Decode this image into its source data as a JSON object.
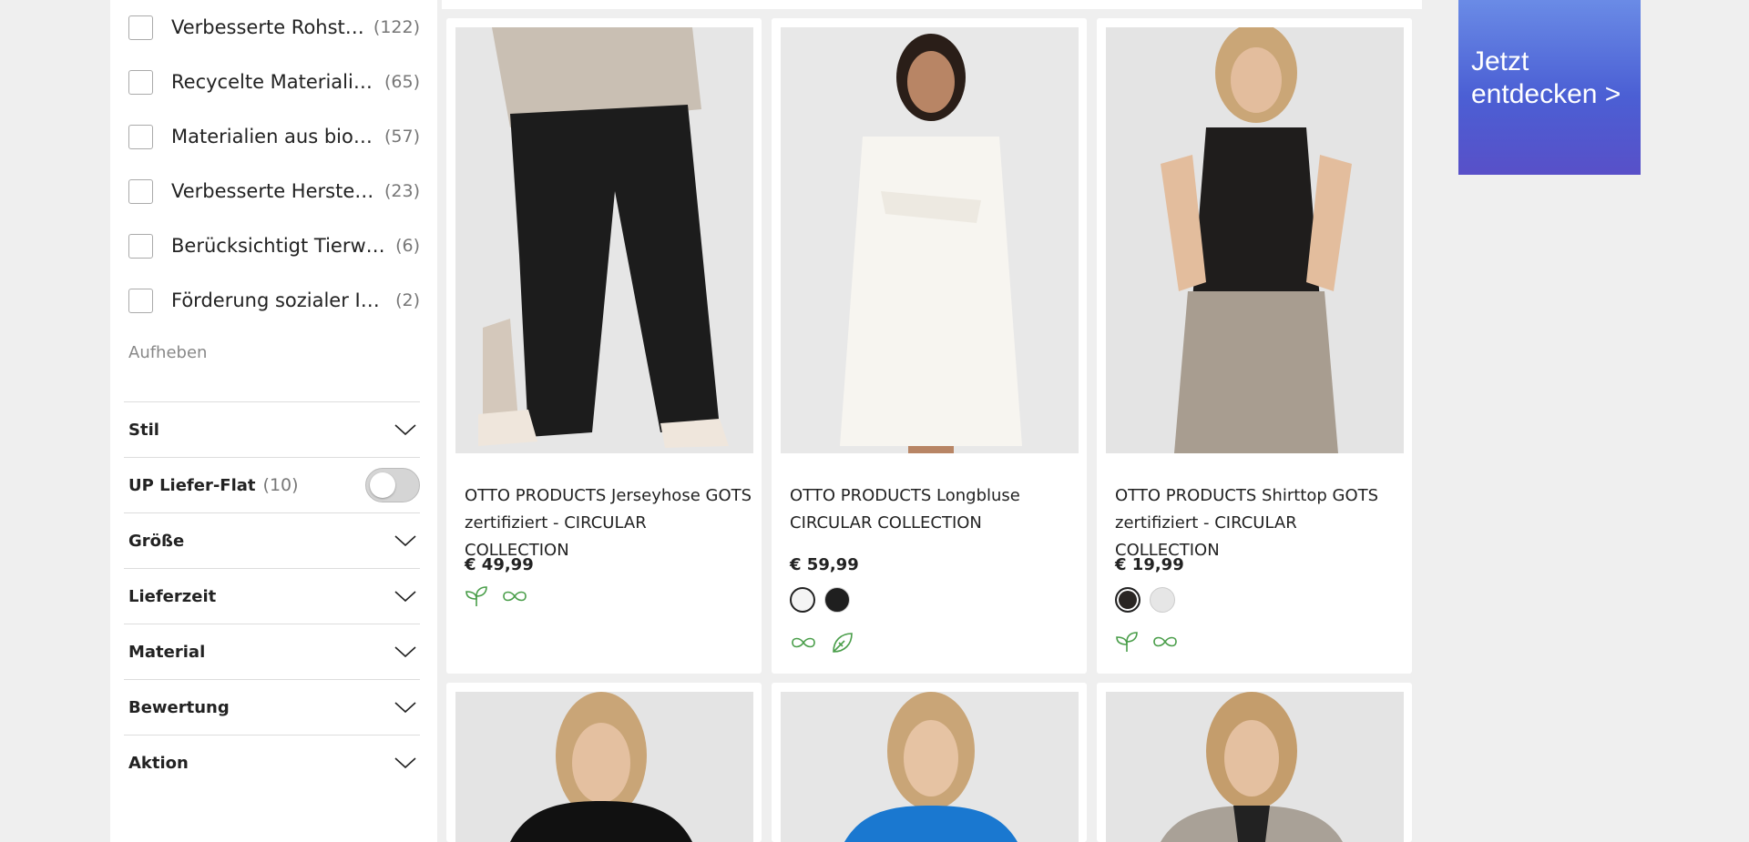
{
  "sustainability_filters": [
    {
      "label": "Verbesserte Rohstoffe",
      "display": "Verbesserte Rohstoff...",
      "count": "(122)"
    },
    {
      "label": "Recycelte Materialien",
      "display": "Recycelte Materialien",
      "count": "(65)"
    },
    {
      "label": "Materialien aus biologischem Anbau",
      "display": "Materialien aus biologi...",
      "count": "(57)"
    },
    {
      "label": "Verbesserte Herstellung",
      "display": "Verbesserte Herstellung",
      "count": "(23)"
    },
    {
      "label": "Berücksichtigt Tierwohl",
      "display": "Berücksichtigt Tierwohl",
      "count": "(6)"
    },
    {
      "label": "Förderung sozialer Initiativen",
      "display": "Förderung sozialer Initia...",
      "count": "(2)"
    }
  ],
  "reset_label": "Aufheben",
  "sections": {
    "stil": "Stil",
    "liefer_flat": {
      "label": "UP Liefer-Flat",
      "count": "(10)"
    },
    "groesse": "Größe",
    "lieferzeit": "Lieferzeit",
    "material": "Material",
    "bewertung": "Bewertung",
    "aktion": "Aktion"
  },
  "products": [
    {
      "title": "OTTO PRODUCTS Jerseyhose GOTS zertifiziert - CIRCULAR COLLECTION",
      "price": "€ 49,99",
      "swatches": [],
      "eco_icons": [
        "leaf-sprout-icon",
        "circular-loop-icon"
      ]
    },
    {
      "title": "OTTO PRODUCTS Longbluse CIRCULAR COLLECTION",
      "price": "€ 59,99",
      "swatches": [
        "#f4f4f4",
        "#1f1f1f"
      ],
      "eco_icons": [
        "circular-loop-icon",
        "recycle-leaf-icon"
      ]
    },
    {
      "title": "OTTO PRODUCTS Shirttop GOTS zertifiziert - CIRCULAR COLLECTION",
      "price": "€ 19,99",
      "swatches": [
        "#2a2623",
        "#e6e6e6"
      ],
      "eco_icons": [
        "leaf-sprout-icon",
        "circular-loop-icon"
      ]
    }
  ],
  "promo": {
    "line1": "Jetzt",
    "line2": "entdecken >"
  },
  "colors": {
    "eco_green": "#4a9e4a",
    "promo_blue": "#4b5fd4"
  }
}
